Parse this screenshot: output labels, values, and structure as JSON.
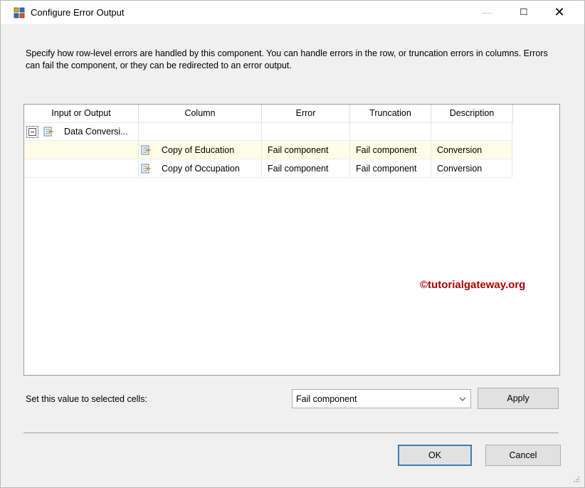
{
  "window": {
    "title": "Configure Error Output",
    "minimize_glyph": "—",
    "maximize_glyph": "☐",
    "close_glyph": "✕"
  },
  "description": "Specify how row-level errors are handled by this component. You can handle errors in the row, or truncation errors in columns. Errors can fail the component, or they can be redirected to an error output.",
  "grid": {
    "columns": [
      "Input or Output",
      "Column",
      "Error",
      "Truncation",
      "Description"
    ],
    "rows": [
      {
        "input_output": "Data Conversi...",
        "column": "",
        "error": "",
        "truncation": "",
        "description": ""
      },
      {
        "input_output": "",
        "column": "Copy of Education",
        "error": "Fail component",
        "truncation": "Fail component",
        "description": "Conversion",
        "selected": true
      },
      {
        "input_output": "",
        "column": "Copy of Occupation",
        "error": "Fail component",
        "truncation": "Fail component",
        "description": "Conversion"
      }
    ]
  },
  "watermark": "©tutorialgateway.org",
  "set_value": {
    "label": "Set this value to selected cells:",
    "selected": "Fail component",
    "apply_label": "Apply"
  },
  "footer": {
    "ok_label": "OK",
    "cancel_label": "Cancel"
  },
  "colors": {
    "selected_row": "#fefde6",
    "watermark": "#b00000",
    "ok_border": "#3c7fb1"
  },
  "icons": [
    "app-icon",
    "collapse-icon",
    "output-icon",
    "column-icon",
    "dropdown-arrow-icon",
    "resize-grip-icon"
  ]
}
